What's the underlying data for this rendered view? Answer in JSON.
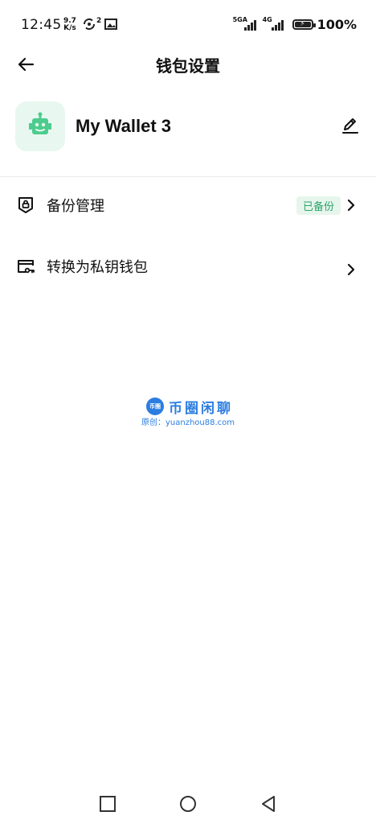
{
  "status_bar": {
    "time": "12:45",
    "speed_value": "9.7",
    "speed_unit": "K/s",
    "sim_count": "2",
    "signal1_label": "5GA",
    "signal2_label": "4G",
    "battery": "100%"
  },
  "header": {
    "title": "钱包设置",
    "back_icon": "arrow-left-icon"
  },
  "wallet": {
    "name": "My Wallet 3",
    "avatar_icon": "robot-icon",
    "edit_icon": "pencil-icon"
  },
  "menu": [
    {
      "label": "备份管理",
      "icon": "shield-lock-icon",
      "badge": "已备份"
    },
    {
      "label": "转换为私钥钱包",
      "icon": "key-card-icon",
      "badge": ""
    }
  ],
  "watermark": {
    "logo_text": "币圈",
    "title": "币圈闲聊",
    "subtitle": "原创：yuanzhou88.com"
  },
  "colors": {
    "accent_green": "#2ea36b",
    "badge_bg": "#e6f6ec",
    "avatar_bg": "#e8f7ef",
    "watermark_blue": "#2b7de0"
  }
}
